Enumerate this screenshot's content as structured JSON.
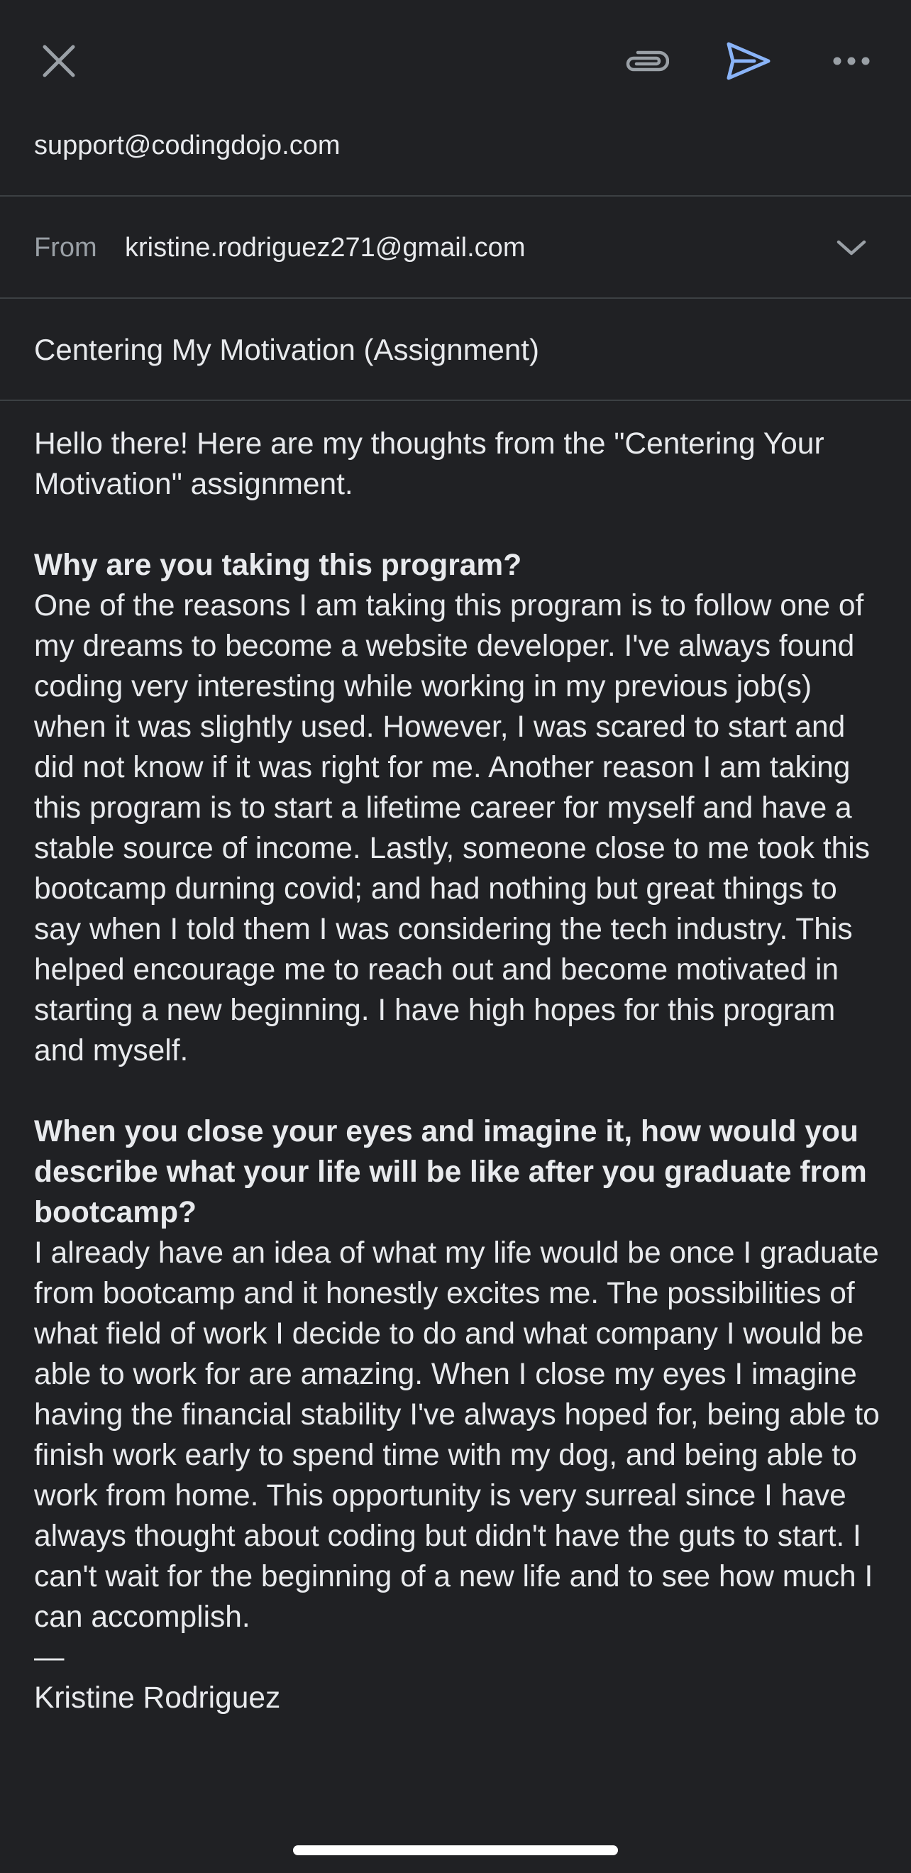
{
  "toolbar": {
    "close_icon": "close-icon",
    "attach_icon": "paperclip-icon",
    "send_icon": "send-icon",
    "more_icon": "more-horizontal-icon",
    "accent_color": "#8ab4f8"
  },
  "compose": {
    "to": "support@codingdojo.com",
    "from_label": "From",
    "from": "kristine.rodriguez271@gmail.com",
    "subject": "Centering My Motivation (Assignment)"
  },
  "body": {
    "intro": "Hello there! Here are my thoughts from the \"Centering Your Motivation\" assignment.",
    "q1": "Why are you taking this program?",
    "a1": "One of the reasons I am taking this program is to follow one of my dreams to become a website developer. I've always found coding very interesting while working in my previous job(s) when it was slightly used. However, I was scared to start and did not know if it was right for me. Another reason I am taking this program is to start a lifetime career for myself and have a stable source of income. Lastly, someone close to me took this bootcamp durning covid; and had nothing but great things to say when I told them I was considering the tech industry. This helped encourage me to reach out and become motivated in starting a new beginning. I have high hopes for this program and myself.",
    "q2": "When you close your eyes and imagine it, how would you describe what your life will be like after you graduate from bootcamp?",
    "a2": "I already have an idea of what my life would be once I graduate from bootcamp and it honestly excites me. The possibilities of what field of work I decide to do and what company I would be able to work for are amazing. When I close my eyes I imagine having the financial stability I've always hoped for, being able to finish work early to spend time with my dog, and being able to work from home. This opportunity is very surreal since I have always thought about coding but didn't have the guts to start. I can't wait for the beginning of a new life and to see how much I can accomplish.",
    "signature_dash": "—",
    "signature_name": "Kristine Rodriguez"
  }
}
